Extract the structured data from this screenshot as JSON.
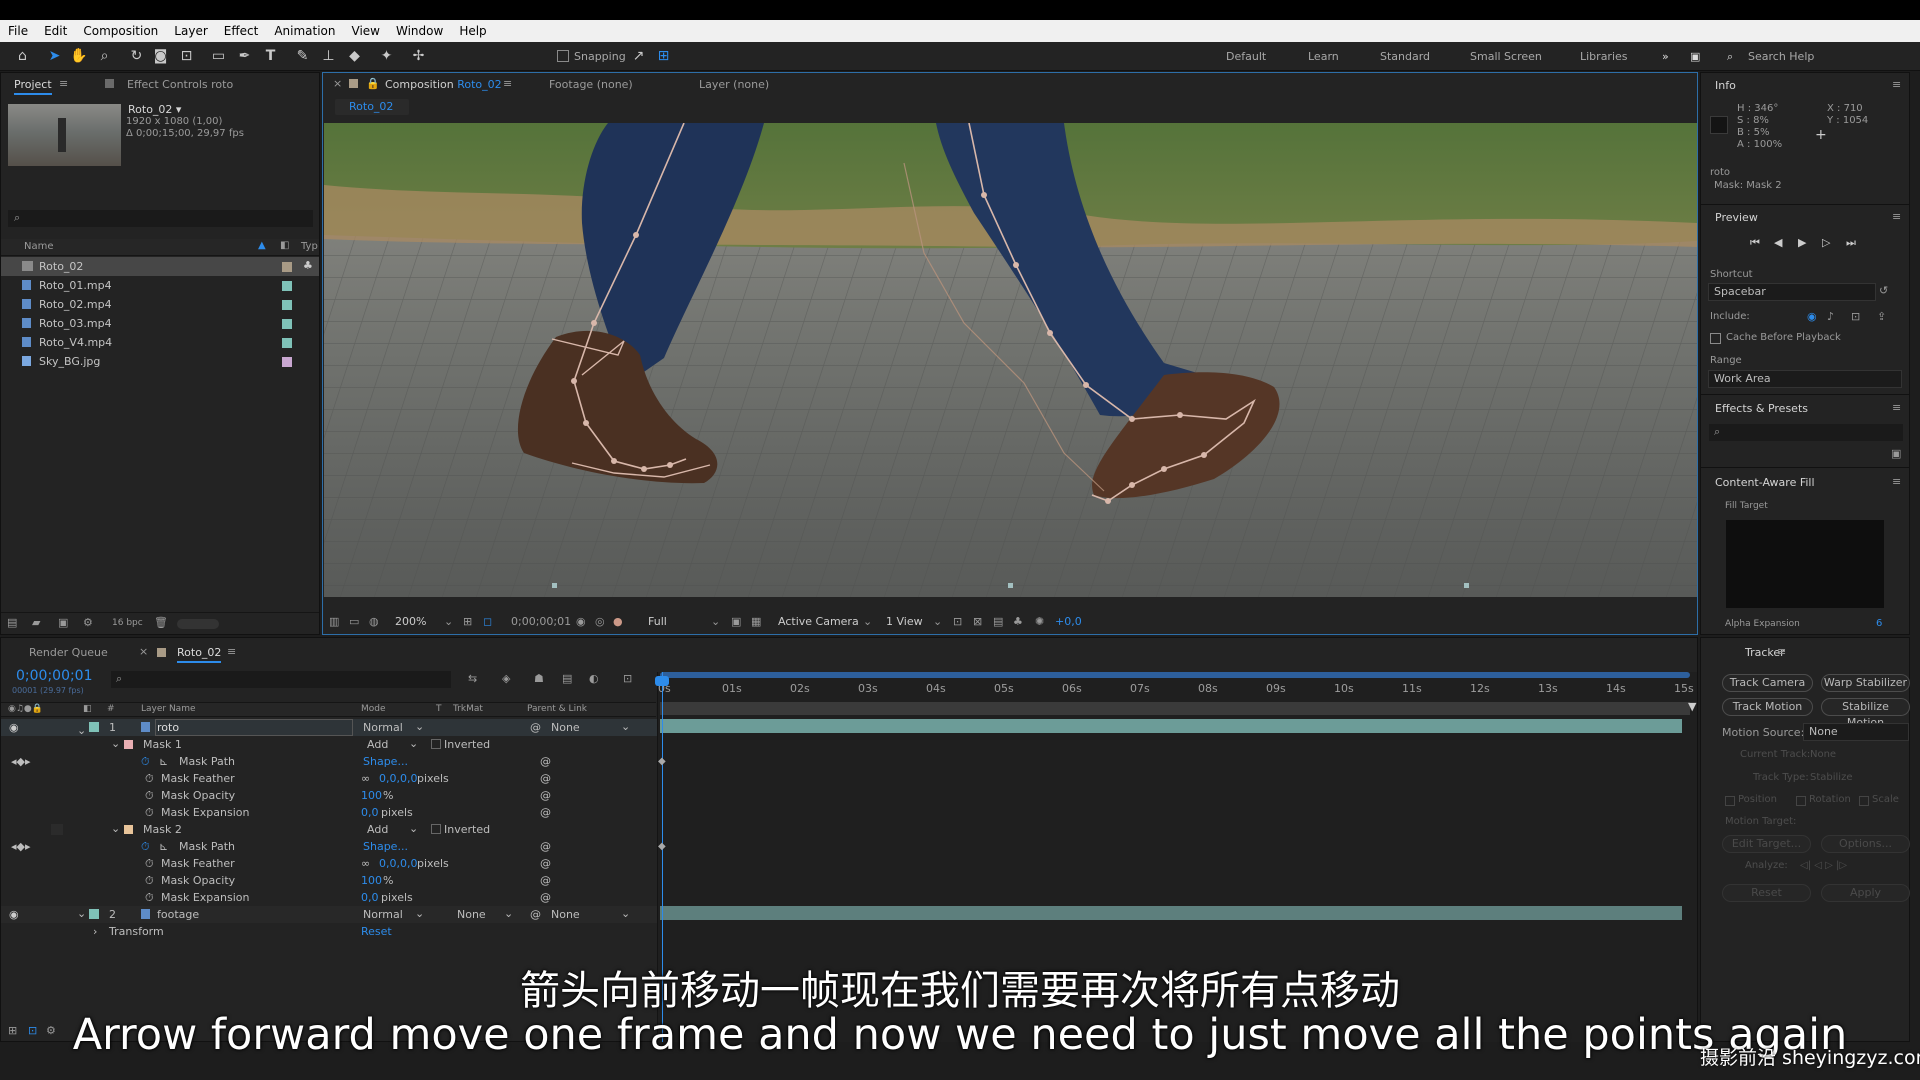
{
  "menu": [
    "File",
    "Edit",
    "Composition",
    "Layer",
    "Effect",
    "Animation",
    "View",
    "Window",
    "Help"
  ],
  "toolbar": {
    "snapping": "Snapping",
    "workspaces": [
      "Default",
      "Learn",
      "Standard",
      "Small Screen",
      "Libraries"
    ],
    "search_placeholder": "Search Help"
  },
  "project": {
    "tab_project": "Project",
    "tab_effect": "Effect Controls roto",
    "comp_name": "Roto_02 ▾",
    "comp_size": "1920 x 1080 (1,00)",
    "comp_duration": "Δ 0;00;15;00, 29,97 fps",
    "col_name": "Name",
    "col_type": "Typ",
    "items": [
      {
        "name": "Roto_02",
        "color": "#a99b86"
      },
      {
        "name": "Roto_01.mp4",
        "color": "#7fc2b8"
      },
      {
        "name": "Roto_02.mp4",
        "color": "#7fc2b8"
      },
      {
        "name": "Roto_03.mp4",
        "color": "#7fc2b8"
      },
      {
        "name": "Roto_V4.mp4",
        "color": "#7fc2b8"
      },
      {
        "name": "Sky_BG.jpg",
        "color": "#c9a7d1"
      }
    ],
    "bpc": "16 bpc"
  },
  "comp": {
    "tab_label": "Composition",
    "tab_name": "Roto_02",
    "footage": "Footage  (none)",
    "layer": "Layer  (none)",
    "breadcrumb": "Roto_02",
    "zoom": "200%",
    "timecode": "0;00;00;01",
    "resolution": "Full",
    "camera": "Active Camera",
    "views": "1 View",
    "exposure": "+0,0"
  },
  "info": {
    "title": "Info",
    "h": "H : 346°",
    "s": "S : 8%",
    "b": "B : 5%",
    "a": "A : 100%",
    "x": "X : 710",
    "y": "Y : 1054",
    "layer": "roto",
    "mask": "Mask: Mask 2"
  },
  "preview": {
    "title": "Preview",
    "shortcut_label": "Shortcut",
    "shortcut": "Spacebar",
    "include": "Include:",
    "cache": "Cache Before Playback",
    "range_label": "Range",
    "range": "Work Area"
  },
  "effects": {
    "title": "Effects & Presets"
  },
  "caf": {
    "title": "Content-Aware Fill",
    "fill_target": "Fill Target",
    "alpha": "Alpha Expansion",
    "alpha_value": "6"
  },
  "timeline": {
    "tab_render": "Render Queue",
    "tab_comp": "Roto_02",
    "timecode": "0;00;00;01",
    "frame_info": "00001 (29.97 fps)",
    "headers": {
      "layer_name": "Layer Name",
      "mode": "Mode",
      "t": "T",
      "trkmat": "TrkMat",
      "parent": "Parent & Link"
    },
    "ruler": [
      "0s",
      "01s",
      "02s",
      "03s",
      "04s",
      "05s",
      "06s",
      "07s",
      "08s",
      "09s",
      "10s",
      "11s",
      "12s",
      "13s",
      "14s",
      "15s"
    ],
    "layer1": {
      "num": "1",
      "name": "roto",
      "mode": "Normal",
      "parent": "None"
    },
    "mask1": {
      "name": "Mask 1",
      "mode": "Add",
      "inverted": "Inverted"
    },
    "mask2": {
      "name": "Mask 2",
      "mode": "Add",
      "inverted": "Inverted"
    },
    "mask_path": "Mask Path",
    "shape": "Shape...",
    "mask_feather": "Mask Feather",
    "feather_val": "0,0,0,0",
    "pixels": "pixels",
    "mask_opacity": "Mask Opacity",
    "opacity_val": "100",
    "percent": "%",
    "mask_expansion": "Mask Expansion",
    "expansion_val": "0,0",
    "layer2": {
      "num": "2",
      "name": "footage",
      "mode": "Normal",
      "trkmat": "None",
      "parent": "None"
    },
    "transform": "Transform",
    "reset": "Reset"
  },
  "tracker": {
    "title": "Tracker",
    "track_camera": "Track Camera",
    "warp": "Warp Stabilizer",
    "track_motion": "Track Motion",
    "stabilize": "Stabilize Motion",
    "motion_source": "Motion Source:",
    "motion_source_val": "None",
    "current_track": "Current Track:",
    "current_track_val": "None",
    "track_type": "Track Type:",
    "track_type_val": "Stabilize",
    "position": "Position",
    "rotation": "Rotation",
    "scale": "Scale",
    "motion_target": "Motion Target:",
    "edit_target": "Edit Target...",
    "options": "Options...",
    "analyze": "Analyze:",
    "reset": "Reset",
    "apply": "Apply"
  },
  "subtitles": {
    "zh": "箭头向前移动一帧现在我们需要再次将所有点移动",
    "en": "Arrow forward move one frame and now we need to just move all the points again",
    "watermark": "摄影前沿 sheyingzyz.com"
  }
}
